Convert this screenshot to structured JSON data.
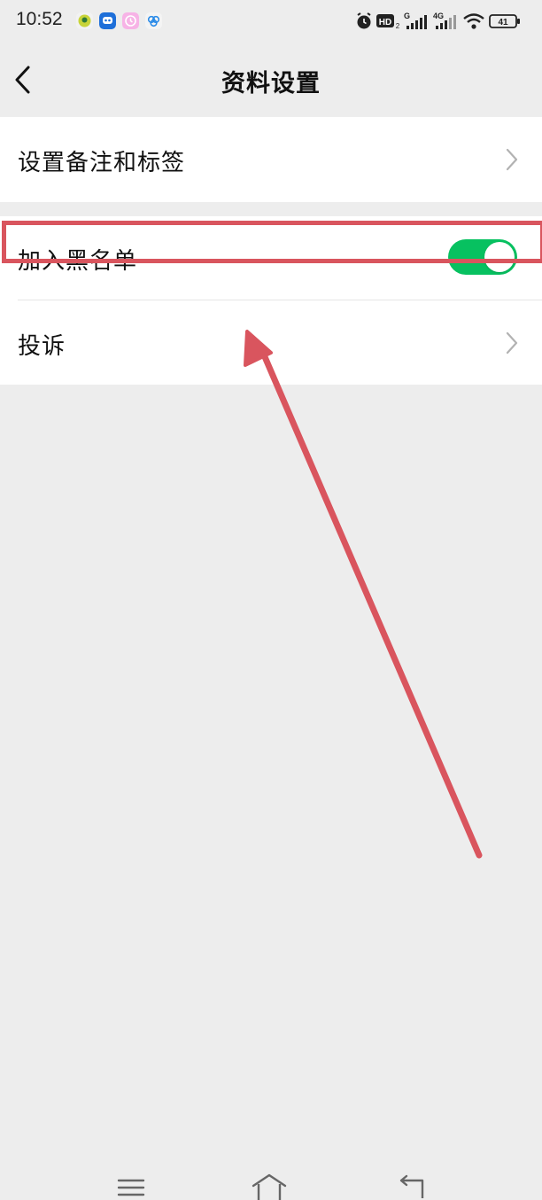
{
  "status_bar": {
    "time": "10:52",
    "battery": "41",
    "network_label": "4G",
    "signal_label": "G",
    "hd_label": "HD"
  },
  "header": {
    "title": "资料设置"
  },
  "settings": {
    "remark_tags": "设置备注和标签",
    "blacklist": "加入黑名单",
    "blacklist_on": true,
    "complaint": "投诉"
  },
  "colors": {
    "accent": "#07c160",
    "annotation": "#d9555e",
    "background": "#ededed"
  }
}
